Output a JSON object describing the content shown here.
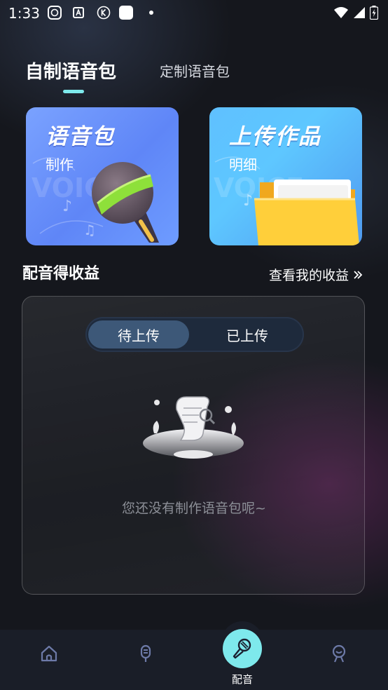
{
  "status": {
    "time": "1:33"
  },
  "tabs": {
    "active": "自制语音包",
    "inactive": "定制语音包"
  },
  "cards": [
    {
      "title": "语音包",
      "subtitle": "制作"
    },
    {
      "title": "上传作品",
      "subtitle": "明细"
    }
  ],
  "earnings": {
    "title": "配音得收益",
    "link": "查看我的收益",
    "link_icon": "double-chevron-right-icon"
  },
  "segmented": {
    "active": "待上传",
    "inactive": "已上传"
  },
  "empty_state": {
    "text": "您还没有制作语音包呢~"
  },
  "bottom_nav": {
    "items": [
      {
        "icon": "home-icon"
      },
      {
        "icon": "microphone-icon"
      },
      {
        "icon": "karaoke-mic-icon",
        "label": "配音",
        "active": true
      },
      {
        "icon": "profile-icon"
      }
    ]
  },
  "colors": {
    "accent": "#7ee9ec",
    "background": "#15171d",
    "nav": "#1a1e28"
  }
}
